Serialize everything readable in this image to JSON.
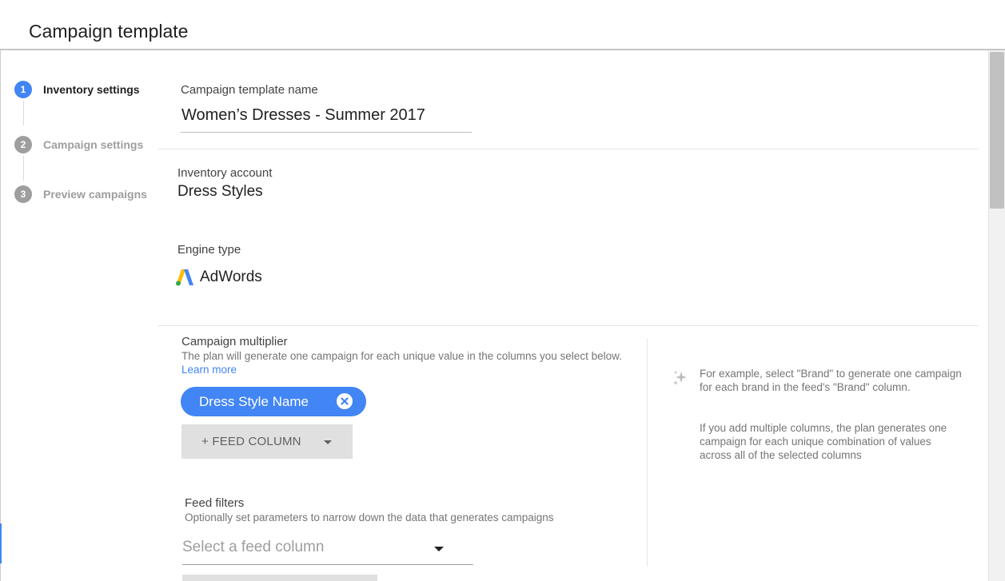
{
  "header": {
    "title": "Campaign template"
  },
  "stepper": {
    "steps": [
      {
        "number": "1",
        "label": "Inventory settings",
        "active": true
      },
      {
        "number": "2",
        "label": "Campaign settings",
        "active": false
      },
      {
        "number": "3",
        "label": "Preview campaigns",
        "active": false
      }
    ]
  },
  "form": {
    "template_name_label": "Campaign template name",
    "template_name_value": "Women’s Dresses - Summer 2017",
    "inventory_account_label": "Inventory account",
    "inventory_account_value": "Dress Styles",
    "engine_type_label": "Engine type",
    "engine_type_value": "AdWords",
    "engine_icon": "adwords-logo"
  },
  "multiplier": {
    "title": "Campaign multiplier",
    "description": "The plan will generate one campaign for each unique value in the columns you select below.",
    "learn_more": "Learn more",
    "chip_label": "Dress Style Name",
    "add_column_button": "+ FEED COLUMN"
  },
  "help": {
    "icon": "sparkle-icon",
    "text1": "For example, select \"Brand\" to generate one campaign for each brand in the feed's \"Brand\" column.",
    "text2": "If you add multiple columns, the plan generates one campaign for each unique combination of values across all of the selected columns"
  },
  "filters": {
    "title": "Feed filters",
    "description": "Optionally set parameters to narrow down the data that generates campaigns",
    "select_placeholder": "Select a feed column"
  },
  "colors": {
    "accent": "#4285f4",
    "step_inactive": "#9e9e9e",
    "chip_bg": "#4285f4",
    "button_bg": "#e0e0e0"
  }
}
